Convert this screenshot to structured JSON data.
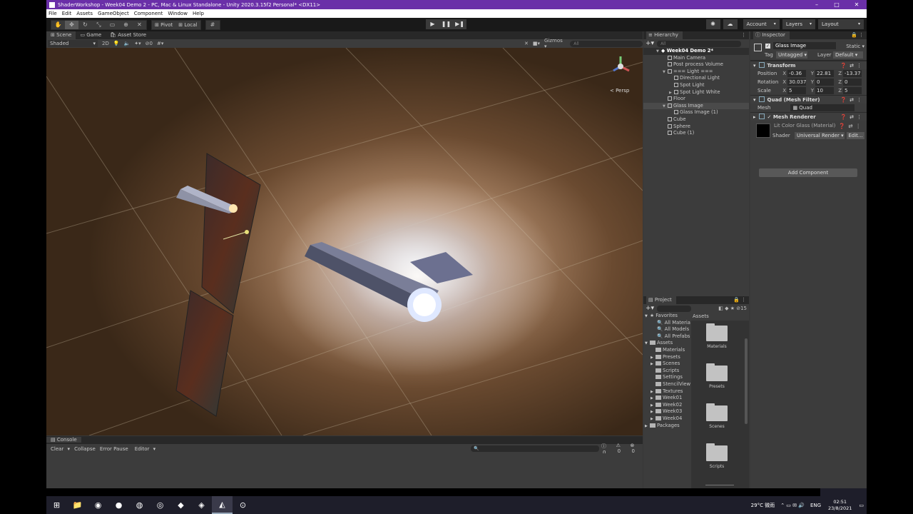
{
  "window": {
    "title": "ShaderWorkshop - Week04 Demo 2 - PC, Mac & Linux Standalone - Unity 2020.3.15f2 Personal* <DX11>",
    "min": "–",
    "max": "□",
    "close": "✕"
  },
  "menu": [
    "File",
    "Edit",
    "Assets",
    "GameObject",
    "Component",
    "Window",
    "Help"
  ],
  "toolbar": {
    "pivot": "Pivot",
    "local": "Local",
    "play": "▶",
    "pause": "❚❚",
    "step": "▶❚",
    "account": "Account",
    "layers": "Layers",
    "layout": "Layout"
  },
  "scene_tabs": [
    "Scene",
    "Game",
    "Asset Store"
  ],
  "scene_ctrl": {
    "shading": "Shaded",
    "mode": "2D",
    "gizmos": "Gizmos",
    "search_placeholder": "All",
    "layers_count": "0"
  },
  "viewport": {
    "persp_label": "< Persp"
  },
  "console": {
    "tab": "Console",
    "clear": "Clear",
    "collapse": "Collapse",
    "error_pause": "Error Pause",
    "editor": "Editor",
    "count_a": "0",
    "count_b": "0",
    "count_c": "0"
  },
  "hierarchy": {
    "tab": "Hierarchy",
    "search_placeholder": "All",
    "scene": "Week04 Demo 2*",
    "items": [
      {
        "label": "Main Camera",
        "indent": 1
      },
      {
        "label": "Post process Volume",
        "indent": 1
      },
      {
        "label": "=== Light ===",
        "indent": 1,
        "expanded": true
      },
      {
        "label": "Directional Light",
        "indent": 2
      },
      {
        "label": "Spot Light",
        "indent": 2
      },
      {
        "label": "Spot Light White",
        "indent": 2,
        "collapsed": true
      },
      {
        "label": "Floor",
        "indent": 1
      },
      {
        "label": "Glass Image",
        "indent": 1,
        "expanded": true,
        "selected": true
      },
      {
        "label": "Glass Image (1)",
        "indent": 2
      },
      {
        "label": "Cube",
        "indent": 1
      },
      {
        "label": "Sphere",
        "indent": 1
      },
      {
        "label": "Cube (1)",
        "indent": 1
      }
    ]
  },
  "project": {
    "tab": "Project",
    "count": "15",
    "favorites_label": "Favorites",
    "favorites": [
      "All Materia",
      "All Models",
      "All Prefabs"
    ],
    "assets_label": "Assets",
    "folders": [
      "Materials",
      "Presets",
      "Scenes",
      "Scripts",
      "Settings",
      "StencilView",
      "Textures",
      "Week01",
      "Week02",
      "Week03",
      "Week04"
    ],
    "packages_label": "Packages",
    "grid_header": "Assets",
    "grid_items": [
      "Materials",
      "Presets",
      "Scenes",
      "Scripts"
    ]
  },
  "inspector": {
    "tab": "Inspector",
    "object_name": "Glass Image",
    "static_label": "Static",
    "tag_label": "Tag",
    "tag_value": "Untagged",
    "layer_label": "Layer",
    "layer_value": "Default",
    "transform": {
      "title": "Transform",
      "position": {
        "label": "Position",
        "x": "-0.36",
        "y": "22.81",
        "z": "-13.37"
      },
      "rotation": {
        "label": "Rotation",
        "x": "30.037",
        "y": "0",
        "z": "0"
      },
      "scale": {
        "label": "Scale",
        "x": "5",
        "y": "10",
        "z": "5"
      }
    },
    "mesh_filter": {
      "title": "Quad (Mesh Filter)",
      "mesh_label": "Mesh",
      "mesh_value": "Quad"
    },
    "mesh_renderer": {
      "title": "Mesh Renderer"
    },
    "material": {
      "name": "Lit Color Glass (Material)",
      "shader_label": "Shader",
      "shader_value": "Universal Render",
      "edit": "Edit..."
    },
    "add_component": "Add Component"
  },
  "taskbar": {
    "weather": "29°C 微雨",
    "lang": "ENG",
    "time": "02:51",
    "date": "23/8/2021"
  },
  "colors": {
    "title_bar": "#6a2fa8",
    "panel_bg": "#3c3c3c",
    "toolbar_bg": "#191919"
  }
}
